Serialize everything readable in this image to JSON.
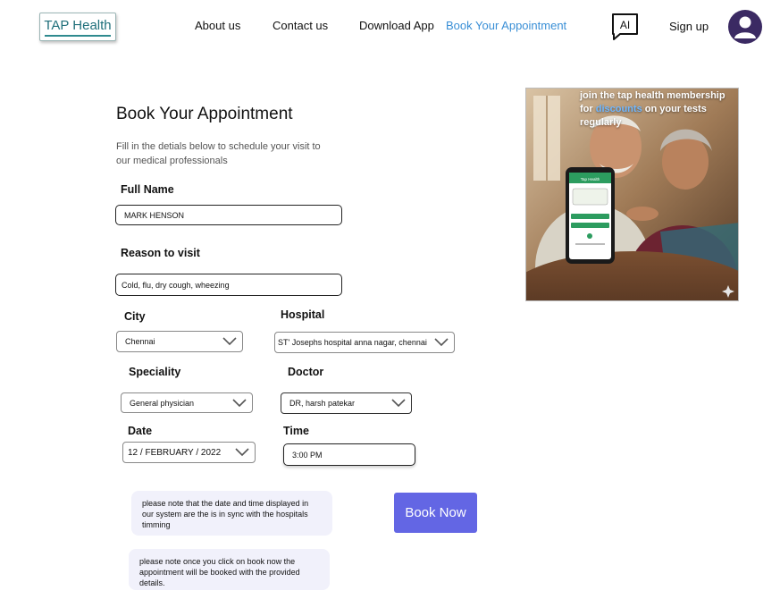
{
  "header": {
    "logo": "TAP Health",
    "nav": [
      {
        "label": "About us"
      },
      {
        "label": "Contact us"
      },
      {
        "label": "Download App"
      },
      {
        "label": "Book Your Appointment"
      }
    ],
    "ai_label": "AI",
    "signup_label": "Sign up"
  },
  "main": {
    "title": "Book Your Appointment",
    "subtitle": "Fill in the detials below to schedule your visit to our medical professionals"
  },
  "form": {
    "full_name_label": "Full Name",
    "full_name_value": "MARK HENSON",
    "reason_label": "Reason to visit",
    "reason_value": "Cold, flu, dry cough, wheezing",
    "city_label": "City",
    "city_value": "Chennai",
    "hospital_label": "Hospital",
    "hospital_value": "ST' Josephs hospital anna nagar, chennai",
    "speciality_label": "Speciality",
    "speciality_value": "General physician",
    "doctor_label": "Doctor",
    "doctor_value": "DR, harsh patekar",
    "date_label": "Date",
    "date_value": "12 / FEBRUARY / 2022",
    "time_label": "Time",
    "time_value": "3:00 PM"
  },
  "notes": [
    "please note that the date and time displayed in our system are the is in sync with the hospitals timming",
    "please note once you click on book now the appointment will be booked with the provided details."
  ],
  "book_button": "Book Now",
  "promo": {
    "text_before": "join the tap health membership for ",
    "highlight": "discounts",
    "text_after": " on your tests regularly",
    "phone_header": "Tap Health",
    "highlight_color": "#6fb7ff"
  },
  "colors": {
    "accent": "#6366e4",
    "nav_active": "#3a8fd6",
    "logo": "#1f6f7a",
    "avatar": "#3b2a63",
    "note_bg": "#f1f1fb"
  }
}
